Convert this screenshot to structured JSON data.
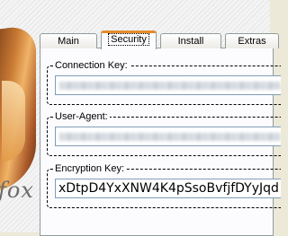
{
  "logo": {
    "text": "fox"
  },
  "tabs": [
    {
      "label": "Main",
      "active": false
    },
    {
      "label": "Security",
      "active": true
    },
    {
      "label": "Install",
      "active": false
    },
    {
      "label": "Extras",
      "active": false
    }
  ],
  "security": {
    "connection_key_label": "Connection Key:",
    "user_agent_label": "User-Agent:",
    "encryption_key_label": "Encryption Key:",
    "encryption_key_value": "xDtpD4YxXNW4K4pSsoBvfjfDYyJqd"
  },
  "colors": {
    "active_tab_accent": "#e68b2c",
    "panel_background": "#fcfcfe",
    "field_border": "#7f9db9"
  }
}
